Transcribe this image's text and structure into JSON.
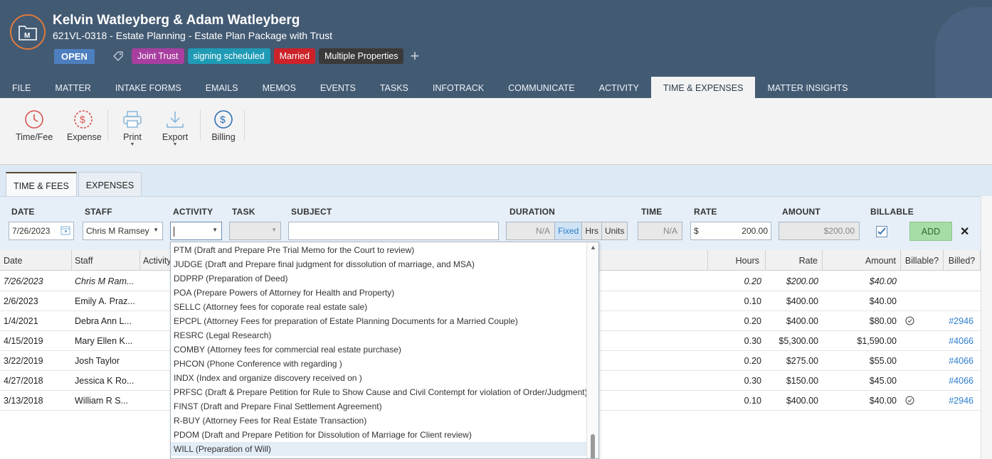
{
  "header": {
    "client_name": "Kelvin Watleyberg & Adam Watleyberg",
    "matter_line": "621VL-0318 - Estate Planning - Estate Plan Package with Trust",
    "status": "OPEN",
    "tags": [
      {
        "label": "Joint Trust",
        "color": "#a83ea0"
      },
      {
        "label": "signing scheduled",
        "color": "#1f9bb5"
      },
      {
        "label": "Married",
        "color": "#cc2229"
      },
      {
        "label": "Multiple Properties",
        "color": "#3a3a3a"
      }
    ],
    "add_tag": "+"
  },
  "tabs": [
    "FILE",
    "MATTER",
    "INTAKE FORMS",
    "EMAILS",
    "MEMOS",
    "EVENTS",
    "TASKS",
    "INFOTRACK",
    "COMMUNICATE",
    "ACTIVITY",
    "TIME & EXPENSES",
    "MATTER INSIGHTS"
  ],
  "ribbon": {
    "time_fee": "Time/Fee",
    "expense": "Expense",
    "print": "Print",
    "export": "Export",
    "billing": "Billing"
  },
  "subtabs": [
    "TIME & FEES",
    "EXPENSES"
  ],
  "entry": {
    "labels": {
      "date": "DATE",
      "staff": "STAFF",
      "activity": "ACTIVITY",
      "task": "TASK",
      "subject": "SUBJECT",
      "duration": "DURATION",
      "time": "TIME",
      "rate": "RATE",
      "amount": "AMOUNT",
      "billable": "BILLABLE"
    },
    "date": "7/26/2023",
    "staff": "Chris M Ramsey",
    "activity": "",
    "task": "",
    "subject": "",
    "duration": "N/A",
    "duration_modes": [
      "Fixed",
      "Hrs",
      "Units"
    ],
    "time": "N/A",
    "rate_prefix": "$",
    "rate": "200.00",
    "amount": "$200.00",
    "billable": true,
    "add": "ADD",
    "close": "✕"
  },
  "grid": {
    "columns": [
      "Date",
      "Staff",
      "Activity",
      "Hours",
      "Rate",
      "Amount",
      "Billable?",
      "Billed?"
    ],
    "rows": [
      {
        "date": "7/26/2023",
        "staff": "Chris M Ram...",
        "hours": "0.20",
        "rate": "$200.00",
        "amount": "$40.00",
        "billable": false,
        "billed": "",
        "italic": true
      },
      {
        "date": "2/6/2023",
        "staff": "Emily A. Praz...",
        "hours": "0.10",
        "rate": "$400.00",
        "amount": "$40.00",
        "billable": false,
        "billed": ""
      },
      {
        "date": "1/4/2021",
        "staff": "Debra Ann L...",
        "hours": "0.20",
        "rate": "$400.00",
        "amount": "$80.00",
        "billable": true,
        "billed": "#2946"
      },
      {
        "date": "4/15/2019",
        "staff": "Mary Ellen K...",
        "hours": "0.30",
        "rate": "$5,300.00",
        "amount": "$1,590.00",
        "billable": false,
        "billed": "#4066"
      },
      {
        "date": "3/22/2019",
        "staff": "Josh Taylor",
        "hours": "0.20",
        "rate": "$275.00",
        "amount": "$55.00",
        "billable": false,
        "billed": "#4066"
      },
      {
        "date": "4/27/2018",
        "staff": "Jessica K Ro...",
        "hours": "0.30",
        "rate": "$150.00",
        "amount": "$45.00",
        "billable": false,
        "billed": "#4066"
      },
      {
        "date": "3/13/2018",
        "staff": "William R S...",
        "hours": "0.10",
        "rate": "$400.00",
        "amount": "$40.00",
        "billable": true,
        "billed": "#2946"
      }
    ]
  },
  "activity_options": [
    "PTM  (Draft and Prepare Pre Trial Memo for the Court to review)",
    "JUDGE  (Draft and Prepare final judgment for dissolution of marriage, and MSA)",
    "DDPRP  (Preparation of Deed)",
    "POA  (Prepare Powers of Attorney for Health and Property)",
    "SELLC  (Attorney fees for coporate real estate sale)",
    "EPCPL  (Attorney Fees for preparation of Estate Planning Documents for a Married Couple)",
    "RESRC  (Legal Research)",
    "COMBY  (Attorney fees for commercial real estate purchase)",
    "PHCON  (Phone Conference with   regarding )",
    "INDX  (Index and organize discovery received on )",
    "PRFSC  (Draft & Prepare Petition for Rule to Show Cause and Civil Contempt for violation of Order/Judgment)",
    "FINST  (Draft and Prepare Final Settlement Agreement)",
    "R-BUY  (Attorney Fees for Real Estate Transaction)",
    "PDOM  (Draft and Prepare Petition for Dissolution of Marriage for Client review)",
    "WILL  (Preparation of Will)"
  ],
  "activity_selected_index": 14
}
